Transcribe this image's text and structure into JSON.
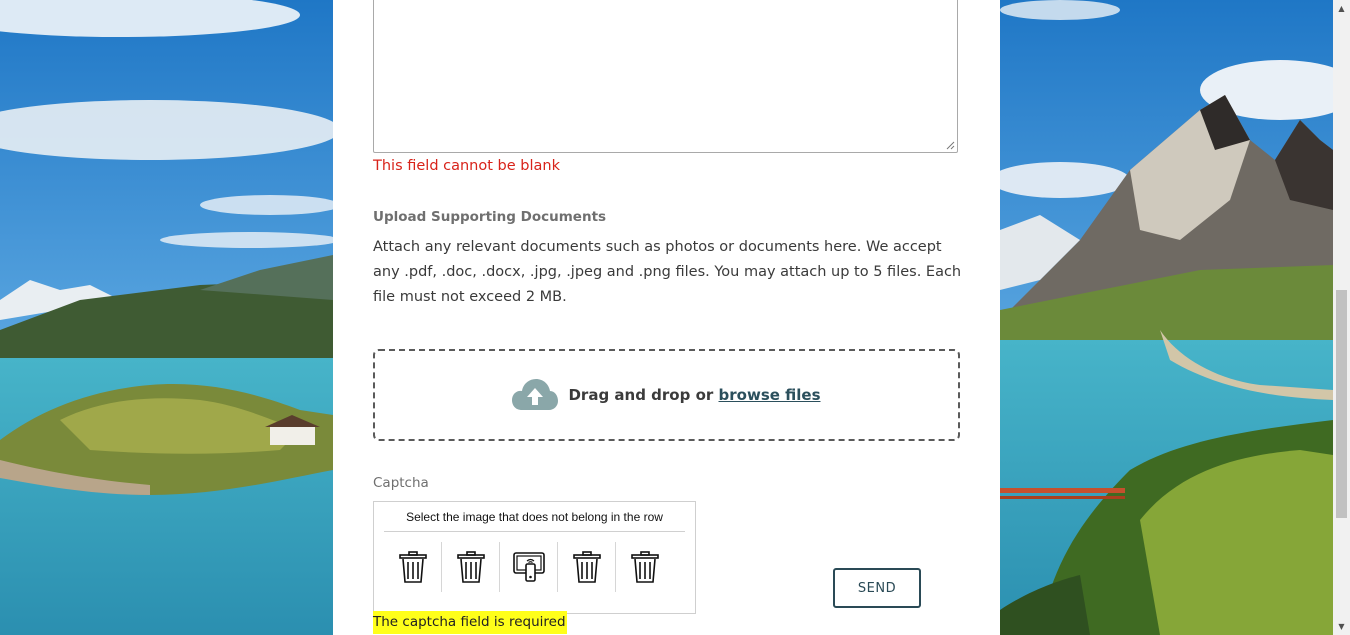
{
  "form": {
    "message_error": "This field cannot be blank",
    "upload": {
      "label": "Upload Supporting Documents",
      "description": "Attach any relevant documents such as photos or documents here. We accept any .pdf, .doc, .docx, .jpg, .jpeg and .png files. You may attach up to 5 files. Each file must not exceed 2 MB.",
      "drop_text": "Drag and drop or",
      "browse_link": "browse files"
    },
    "captcha": {
      "label": "Captcha",
      "instruction": "Select the image that does not belong in the row",
      "icons": [
        "trash-icon",
        "trash-icon",
        "wireless-device-icon",
        "trash-icon",
        "trash-icon"
      ],
      "error": "The captcha field is required"
    },
    "send_label": "SEND"
  },
  "colors": {
    "error": "#d8231a",
    "highlight": "#ffff1a",
    "accent": "#2a4a56"
  }
}
